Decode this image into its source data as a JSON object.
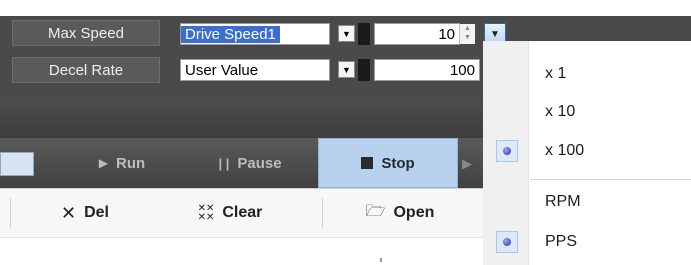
{
  "params": [
    {
      "label": "Max Speed",
      "combo_value": "Drive Speed1",
      "numeric_value": "10"
    },
    {
      "label": "Decel Rate",
      "combo_value": "User Value",
      "numeric_value": "100"
    }
  ],
  "toolbar": {
    "run_label": "Run",
    "pause_label": "Pause",
    "stop_label": "Stop"
  },
  "actions": {
    "del_label": "Del",
    "clear_label": "Clear",
    "open_label": "Open"
  },
  "menu": {
    "multiplier_items": [
      {
        "label": "x 1",
        "selected": false
      },
      {
        "label": "x 10",
        "selected": false
      },
      {
        "label": "x 100",
        "selected": true
      }
    ],
    "unit_items": [
      {
        "label": "RPM",
        "selected": false
      },
      {
        "label": "PPS",
        "selected": true
      }
    ]
  },
  "colors": {
    "panel_bg": "#4a4a4a",
    "selection": "#3a6fd0",
    "stop_active": "#b8d2ee",
    "radio_dot": "#2a2f9c"
  }
}
